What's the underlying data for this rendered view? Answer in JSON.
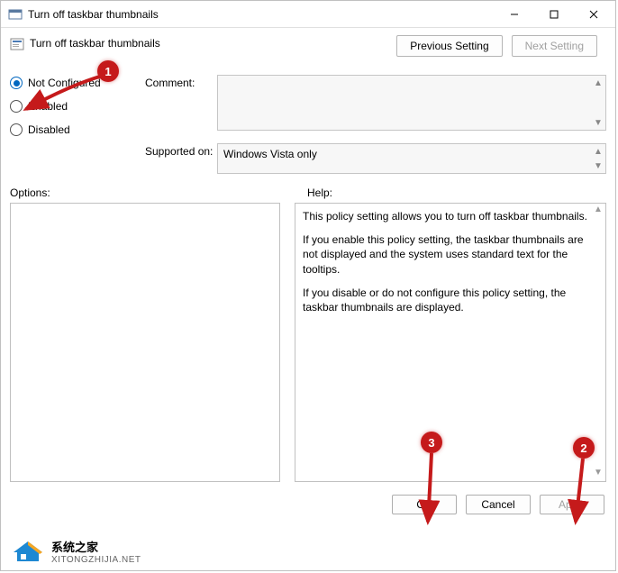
{
  "window": {
    "title": "Turn off taskbar thumbnails"
  },
  "policy": {
    "name": "Turn off taskbar thumbnails"
  },
  "nav": {
    "prev": "Previous Setting",
    "next": "Next Setting"
  },
  "radios": {
    "not_configured": "Not Configured",
    "enabled": "Enabled",
    "disabled": "Disabled",
    "selected": "not_configured"
  },
  "fields": {
    "comment_label": "Comment:",
    "comment_value": "",
    "supported_label": "Supported on:",
    "supported_value": "Windows Vista only"
  },
  "sections": {
    "options_label": "Options:",
    "help_label": "Help:"
  },
  "help_text": {
    "p1": "This policy setting allows you to turn off taskbar thumbnails.",
    "p2": "If you enable this policy setting, the taskbar thumbnails are not displayed and the system uses standard text for the tooltips.",
    "p3": "If you disable or do not configure this policy setting, the taskbar thumbnails are displayed."
  },
  "buttons": {
    "ok": "OK",
    "cancel": "Cancel",
    "apply": "Apply"
  },
  "annotations": {
    "c1": "1",
    "c2": "2",
    "c3": "3"
  },
  "watermark": {
    "name": "系统之家",
    "domain": "XITONGZHIJIA.NET"
  }
}
